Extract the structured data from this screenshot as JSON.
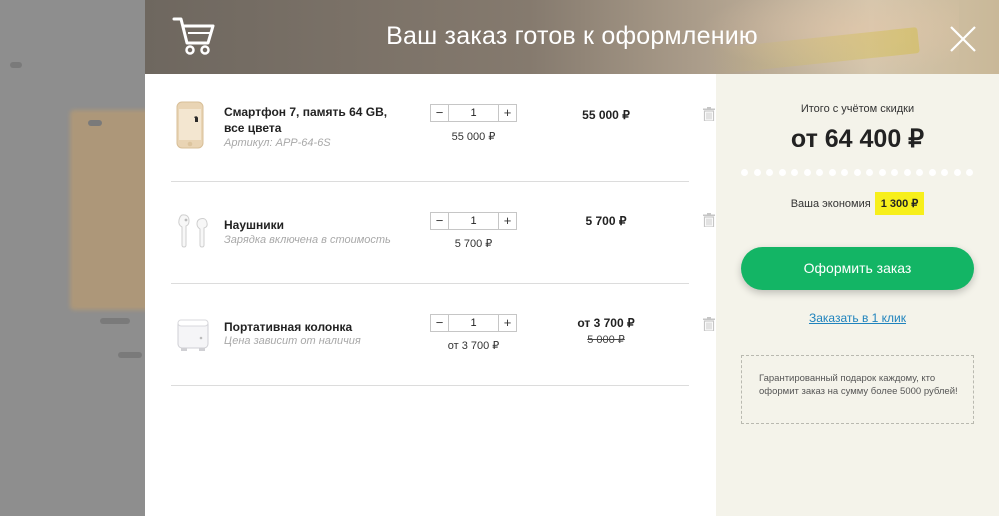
{
  "modal": {
    "title": "Ваш заказ готов к оформлению"
  },
  "items": [
    {
      "name": "Смартфон 7, память 64 GB, все цвета",
      "note": "Артикул: APP-64-6S",
      "quantity": "1",
      "unit_price": "55 000 ₽",
      "line_total": "55 000 ₽",
      "image": "smartphone-gold"
    },
    {
      "name": "Наушники",
      "note": "Зарядка включена в стоимость",
      "quantity": "1",
      "unit_price": "5 700 ₽",
      "line_total": "5 700 ₽",
      "image": "earbuds-white"
    },
    {
      "name": "Портативная колонка",
      "note": "Цена зависит от наличия",
      "quantity": "1",
      "unit_price": "от 3 700 ₽",
      "line_total": "от 3 700 ₽",
      "old_price": "5 000 ₽",
      "image": "speaker-white"
    }
  ],
  "stepper": {
    "minus": "−",
    "plus": "+"
  },
  "summary": {
    "total_label": "Итого с учётом скидки",
    "total_value": "от 64 400 ₽",
    "savings_label": "Ваша экономия",
    "savings_value": "1 300 ₽",
    "checkout_label": "Оформить заказ",
    "oneclick_label": "Заказать в 1 клик",
    "promo_text": "Гарантированный подарок каждому, кто оформит заказ на сумму более 5000 рублей!"
  },
  "colors": {
    "accent_green": "#13b565",
    "link_blue": "#1f83bd",
    "highlight_yellow": "#f7ef1b",
    "sidebar_bg": "#f4f3ea"
  },
  "icons": [
    "cart-icon",
    "close-icon",
    "minus-icon",
    "plus-icon",
    "trash-icon"
  ]
}
